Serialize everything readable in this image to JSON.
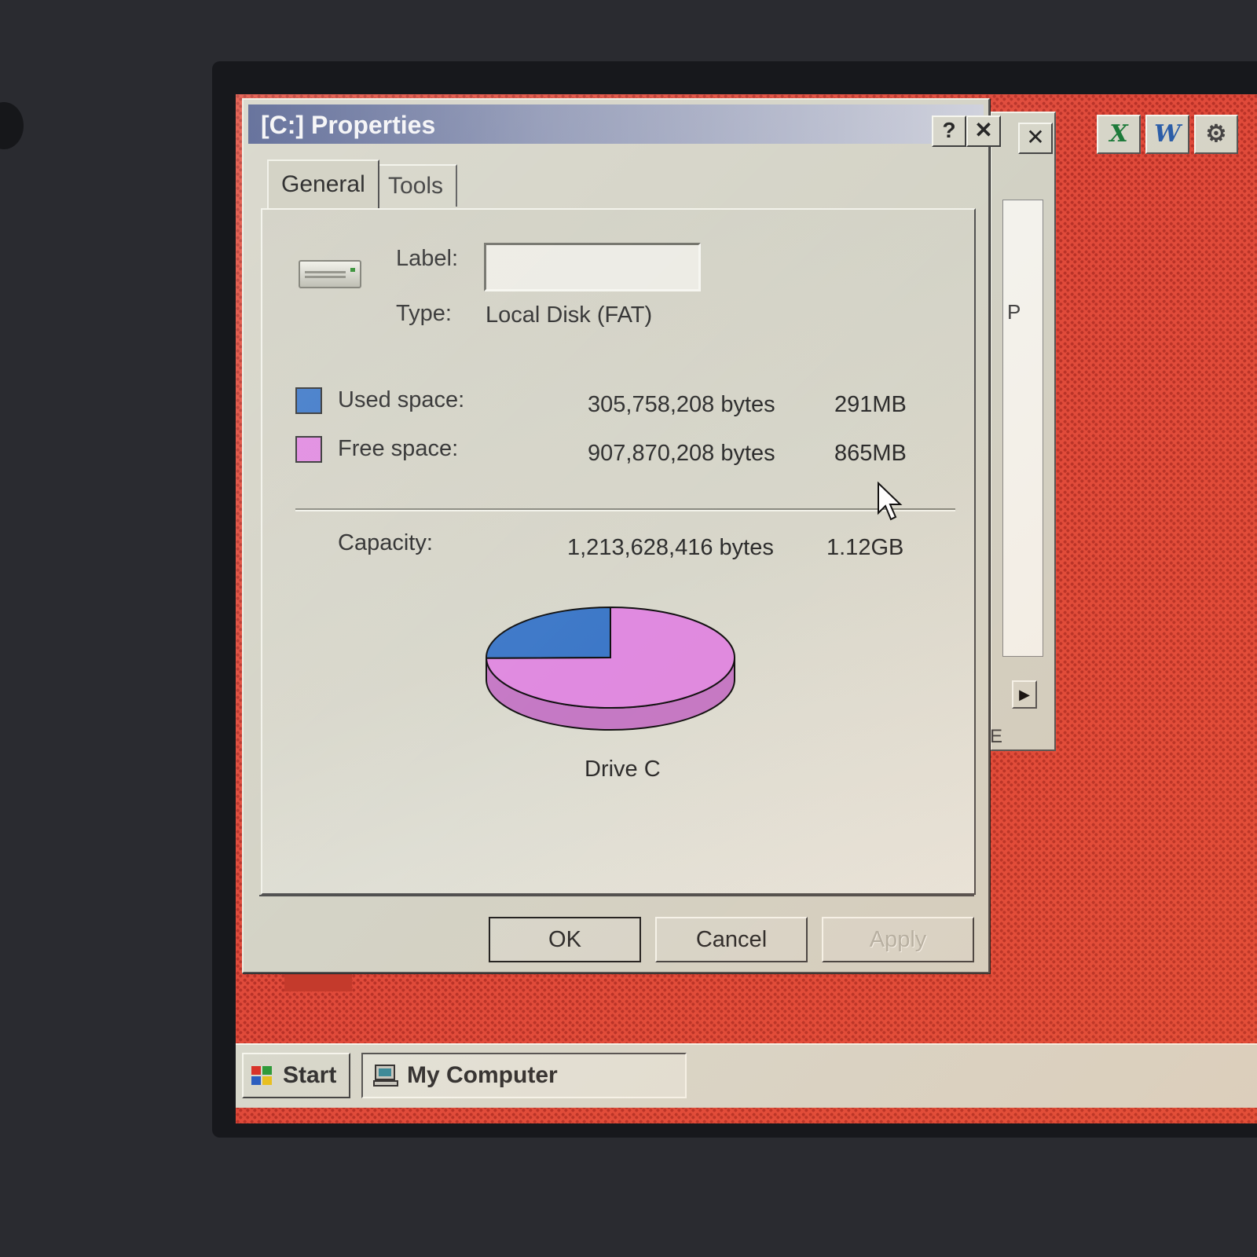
{
  "dialog": {
    "title": "[C:] Properties",
    "help_button": "?",
    "close_button": "✕"
  },
  "tabs": [
    {
      "label": "General",
      "active": true
    },
    {
      "label": "Tools",
      "active": false
    }
  ],
  "general": {
    "label_caption": "Label:",
    "label_value": "",
    "type_caption": "Type:",
    "type_value": "Local Disk (FAT)",
    "used": {
      "caption": "Used space:",
      "bytes": "305,758,208 bytes",
      "size": "291MB",
      "color": "#3d78c8"
    },
    "free": {
      "caption": "Free space:",
      "bytes": "907,870,208 bytes",
      "size": "865MB",
      "color": "#e08ae0"
    },
    "capacity": {
      "caption": "Capacity:",
      "bytes": "1,213,628,416 bytes",
      "size": "1.12GB"
    }
  },
  "chart_data": {
    "type": "pie",
    "categories": [
      "Used space",
      "Free space"
    ],
    "values": [
      305758208,
      907870208
    ],
    "colors": [
      "#3d78c8",
      "#e08ae0"
    ],
    "label": "Drive C"
  },
  "buttons": {
    "ok": "OK",
    "cancel": "Cancel",
    "apply": "Apply"
  },
  "background_window": {
    "close": "✕",
    "partial_text_1": "P",
    "partial_text_2": "E",
    "scroll_arrow": "▶"
  },
  "tray": [
    {
      "icon": "excel-icon",
      "glyph": "X",
      "color": "#1d7a3a"
    },
    {
      "icon": "word-icon",
      "glyph": "W",
      "color": "#2a5da8"
    },
    {
      "icon": "app-icon",
      "glyph": "⚙",
      "color": "#444"
    }
  ],
  "taskbar": {
    "start": "Start",
    "task": "My Computer"
  }
}
